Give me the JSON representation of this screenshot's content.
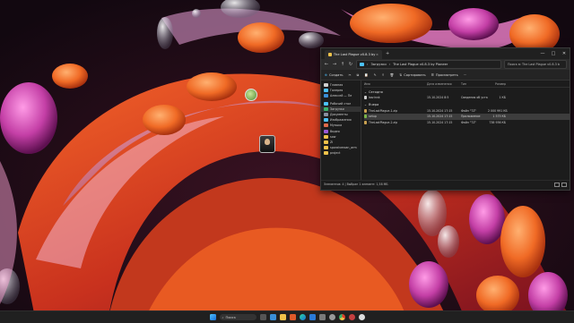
{
  "colors": {
    "accent": "#4cc2ff",
    "folder": "#f0c24a",
    "window_bg": "#1c1c1c"
  },
  "desktop": {
    "icons": [
      {
        "name": "app-shortcut-icon",
        "label": ""
      },
      {
        "name": "image-file-icon",
        "label": ""
      }
    ]
  },
  "explorer": {
    "tab_title": "The Last Plague v0.8.3 by Pioneer",
    "tab_close": "×",
    "new_tab": "+",
    "window_buttons": [
      "—",
      "□",
      "✕"
    ],
    "address": {
      "segments": [
        "Загрузки",
        "The Last Plague v0.8.3 by Pioneer"
      ],
      "separator": "›"
    },
    "search_placeholder": "Поиск в: The Last Plague v0.8.3 b",
    "toolbar": {
      "create": "Создать",
      "sort": "Сортировать",
      "view": "Просмотреть",
      "more": "···"
    },
    "nav_items": [
      {
        "icon": "home-icon",
        "label": "Главная"
      },
      {
        "icon": "gallery-icon",
        "label": "Галерея"
      },
      {
        "icon": "cloud-icon",
        "label": "Алексей — Пе"
      },
      {
        "icon": "desktop-icon",
        "label": "Рабочий стол"
      },
      {
        "icon": "download-icon",
        "label": "Загрузки"
      },
      {
        "icon": "documents-icon",
        "label": "Документы"
      },
      {
        "icon": "pictures-icon",
        "label": "Изображения"
      },
      {
        "icon": "music-icon",
        "label": "Музыка"
      },
      {
        "icon": "video-icon",
        "label": "Видео"
      },
      {
        "icon": "folder-icon",
        "label": "sow"
      },
      {
        "icon": "folder-icon",
        "label": "ZI"
      },
      {
        "icon": "folder-icon",
        "label": "sporalveroan_arm"
      },
      {
        "icon": "folder-icon",
        "label": "project"
      }
    ],
    "columns": [
      "Имя",
      "Дата изменения",
      "Тип",
      "Размер"
    ],
    "groups": [
      {
        "title": "Сегодня",
        "rows": [
          {
            "icon": "file-icon",
            "name": "lasrinnk",
            "date": "15.10.2024 8:5",
            "type": "Сведения об уста...",
            "size": "1 КБ",
            "selected": false
          }
        ]
      },
      {
        "title": "Вчера",
        "rows": [
          {
            "icon": "archive-icon",
            "name": "TheLastPlague-1.zip",
            "date": "15.10.2024 17:15",
            "type": "Файл \"7Z\"",
            "size": "2 000 991 КБ",
            "selected": false
          },
          {
            "icon": "setup-icon",
            "name": "setup",
            "date": "15.10.2024 17:15",
            "type": "Приложение",
            "size": "1 575 КБ",
            "selected": true
          },
          {
            "icon": "archive-icon",
            "name": "TheLastPlague-2.zip",
            "date": "15.10.2024 17:15",
            "type": "Файл \"7Z\"",
            "size": "738 936 КБ",
            "selected": false
          }
        ]
      }
    ],
    "status": "Элементов: 4  |  Выбран 1 элемент: 1,58 МБ"
  },
  "taskbar": {
    "search_label": "Поиск",
    "apps": [
      "start-icon",
      "task-view-icon",
      "widgets-icon",
      "explorer-icon",
      "browser-icon",
      "edge-icon",
      "store-icon",
      "mail-icon",
      "settings-icon",
      "chrome-icon",
      "media-icon",
      "game-icon"
    ]
  }
}
